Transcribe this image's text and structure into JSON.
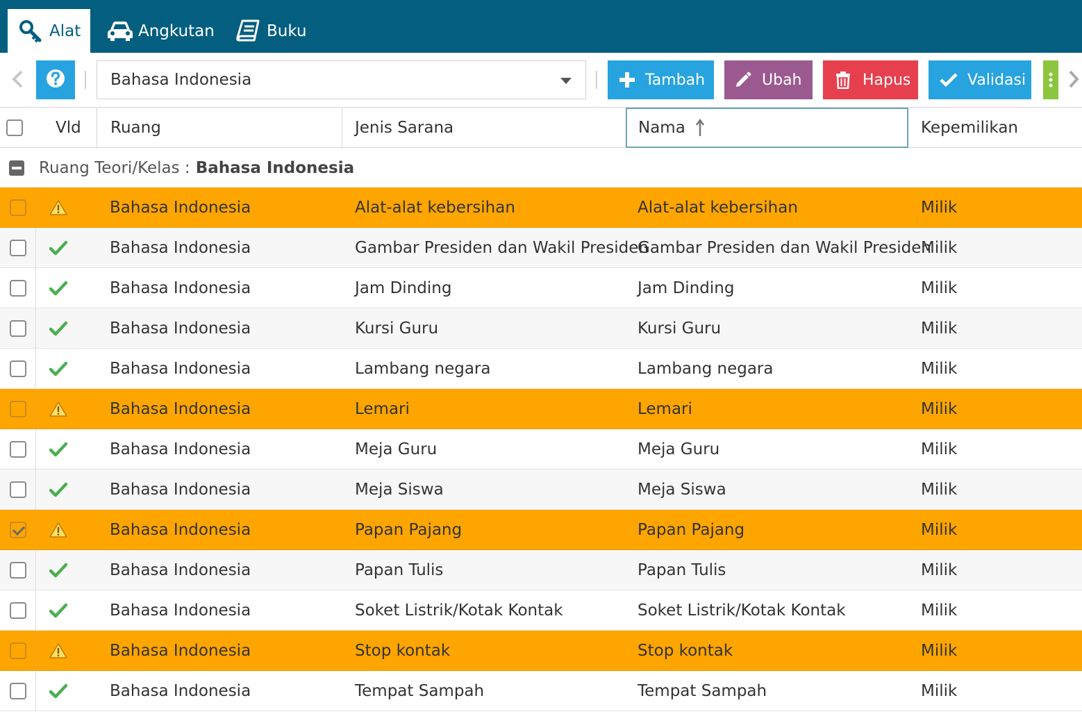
{
  "tabs": [
    {
      "label": "Alat",
      "icon": "key-search-icon",
      "active": true
    },
    {
      "label": "Angkutan",
      "icon": "car-icon",
      "active": false
    },
    {
      "label": "Buku",
      "icon": "book-icon",
      "active": false
    }
  ],
  "toolbar": {
    "help_icon": "question-circle-icon",
    "select_value": "Bahasa Indonesia",
    "buttons": [
      {
        "label": "Tambah",
        "icon": "plus-icon",
        "color": "#27a3e0"
      },
      {
        "label": "Ubah",
        "icon": "pencil-icon",
        "color": "#9b5a8f"
      },
      {
        "label": "Hapus",
        "icon": "trash-icon",
        "color": "#e6404e"
      },
      {
        "label": "Validasi",
        "icon": "check-icon",
        "color": "#27a3e0"
      }
    ],
    "more_color": "#8cc63f"
  },
  "table": {
    "headers": {
      "vld": "Vld",
      "ruang": "Ruang",
      "jenis": "Jenis Sarana",
      "nama": "Nama",
      "kepemilikan": "Kepemilikan"
    },
    "sorted_column": "nama",
    "group": {
      "label": "Ruang Teori/Kelas :",
      "value": "Bahasa Indonesia"
    },
    "rows": [
      {
        "status": "warning",
        "checked": false,
        "ruang": "Bahasa Indonesia",
        "jenis": "Alat-alat kebersihan",
        "nama": "Alat-alat kebersihan",
        "kepemilikan": "Milik"
      },
      {
        "status": "valid",
        "checked": false,
        "ruang": "Bahasa Indonesia",
        "jenis": "Gambar Presiden dan Wakil Presiden",
        "nama": "Gambar Presiden dan Wakil Presiden",
        "kepemilikan": "Milik"
      },
      {
        "status": "valid",
        "checked": false,
        "ruang": "Bahasa Indonesia",
        "jenis": "Jam Dinding",
        "nama": "Jam Dinding",
        "kepemilikan": "Milik"
      },
      {
        "status": "valid",
        "checked": false,
        "ruang": "Bahasa Indonesia",
        "jenis": "Kursi Guru",
        "nama": "Kursi Guru",
        "kepemilikan": "Milik"
      },
      {
        "status": "valid",
        "checked": false,
        "ruang": "Bahasa Indonesia",
        "jenis": "Lambang negara",
        "nama": "Lambang negara",
        "kepemilikan": "Milik"
      },
      {
        "status": "warning",
        "checked": false,
        "ruang": "Bahasa Indonesia",
        "jenis": "Lemari",
        "nama": "Lemari",
        "kepemilikan": "Milik"
      },
      {
        "status": "valid",
        "checked": false,
        "ruang": "Bahasa Indonesia",
        "jenis": "Meja Guru",
        "nama": "Meja Guru",
        "kepemilikan": "Milik"
      },
      {
        "status": "valid",
        "checked": false,
        "ruang": "Bahasa Indonesia",
        "jenis": "Meja Siswa",
        "nama": "Meja Siswa",
        "kepemilikan": "Milik"
      },
      {
        "status": "warning",
        "checked": true,
        "ruang": "Bahasa Indonesia",
        "jenis": "Papan Pajang",
        "nama": "Papan Pajang",
        "kepemilikan": "Milik"
      },
      {
        "status": "valid",
        "checked": false,
        "ruang": "Bahasa Indonesia",
        "jenis": "Papan Tulis",
        "nama": "Papan Tulis",
        "kepemilikan": "Milik"
      },
      {
        "status": "valid",
        "checked": false,
        "ruang": "Bahasa Indonesia",
        "jenis": "Soket Listrik/Kotak Kontak",
        "nama": "Soket Listrik/Kotak Kontak",
        "kepemilikan": "Milik"
      },
      {
        "status": "warning",
        "checked": false,
        "ruang": "Bahasa Indonesia",
        "jenis": "Stop kontak",
        "nama": "Stop kontak",
        "kepemilikan": "Milik"
      },
      {
        "status": "valid",
        "checked": false,
        "ruang": "Bahasa Indonesia",
        "jenis": "Tempat Sampah",
        "nama": "Tempat Sampah",
        "kepemilikan": "Milik"
      }
    ]
  },
  "colors": {
    "header_bar": "#035e80",
    "warning_row": "#ffa500",
    "valid_check": "#4caf50",
    "warning_icon": "#ffe066"
  }
}
